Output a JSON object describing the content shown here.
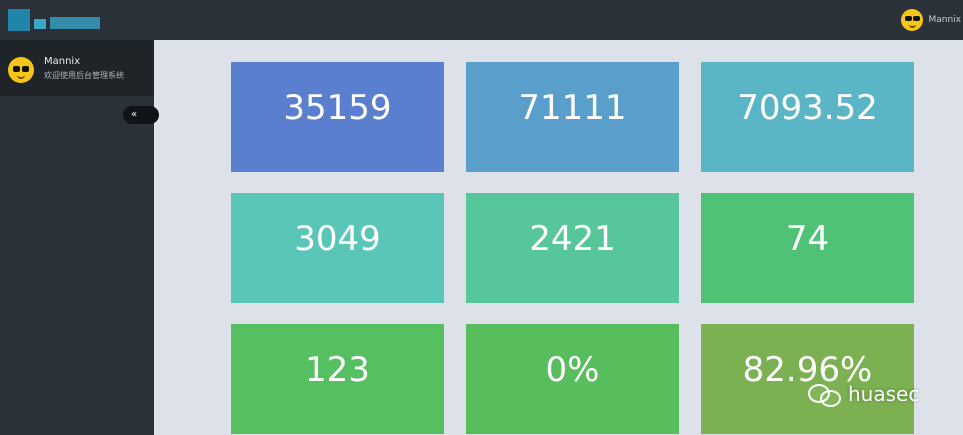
{
  "header": {
    "logo_text": "",
    "user_name": "Mannix"
  },
  "sidebar": {
    "user_name": "Mannix",
    "welcome_text": "欢迎使用后台管理系统",
    "collapse_label": "«"
  },
  "cards": [
    {
      "value": "35159",
      "label": "",
      "color": "#5a7fcf"
    },
    {
      "value": "71111",
      "label": "",
      "color": "#5a9ecb"
    },
    {
      "value": "7093.52",
      "label": "",
      "color": "#5ab6c6"
    },
    {
      "value": "3049",
      "label": "",
      "color": "#5ac6b8"
    },
    {
      "value": "2421",
      "label": "",
      "color": "#57c69a"
    },
    {
      "value": "74",
      "label": "",
      "color": "#4fc276"
    },
    {
      "value": "123",
      "label": "",
      "color": "#55bf62"
    },
    {
      "value": "0%",
      "label": "",
      "color": "#58bd5c"
    },
    {
      "value": "82.96%",
      "label": "",
      "color": "#7bb151"
    }
  ],
  "watermark": {
    "text": "huasec"
  }
}
